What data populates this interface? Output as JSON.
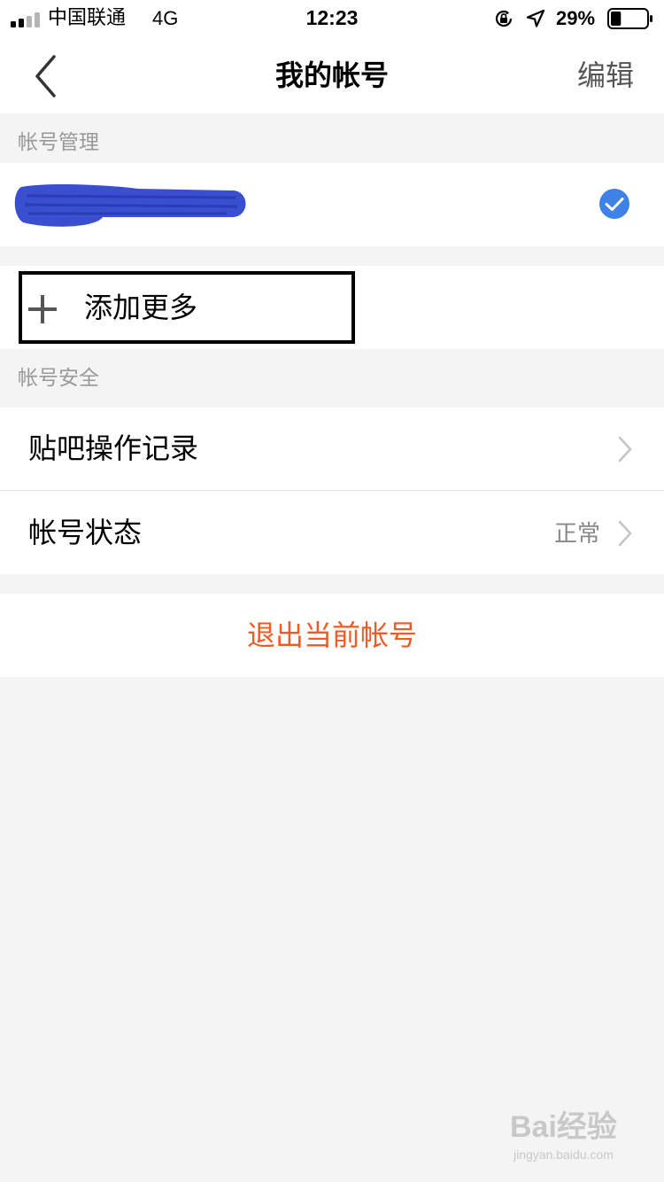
{
  "status_bar": {
    "carrier": "中国联通",
    "network": "4G",
    "time": "12:23",
    "battery_percent": "29%",
    "battery_level": 0.29,
    "signal_bars_filled": 2,
    "icons": [
      "signal-icon",
      "orientation-lock-icon",
      "location-arrow-icon",
      "battery-icon"
    ]
  },
  "nav": {
    "title": "我的帐号",
    "edit_label": "编辑",
    "back_icon": "chevron-left-icon"
  },
  "account_management": {
    "header": "帐号管理",
    "account_name": "",
    "selected_icon": "check-circle-icon",
    "accent_color": "#3e82e8",
    "add_more_label": "添加更多",
    "add_icon": "plus-icon"
  },
  "account_security": {
    "header": "帐号安全",
    "items": [
      {
        "label": "贴吧操作记录",
        "value": ""
      },
      {
        "label": "帐号状态",
        "value": "正常"
      }
    ]
  },
  "logout": {
    "label": "退出当前帐号",
    "color": "#f25a25"
  },
  "watermark": {
    "logo": "Bai经验",
    "url": "jingyan.baidu.com"
  }
}
